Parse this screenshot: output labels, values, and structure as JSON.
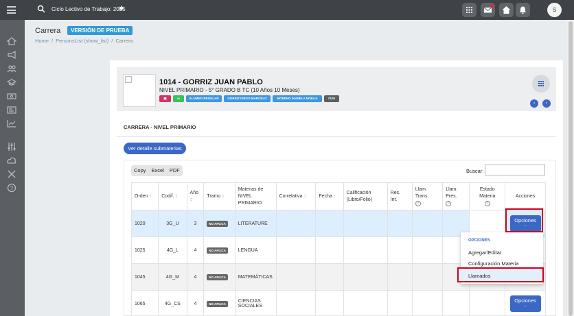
{
  "topbar": {
    "cycle_label": "Ciclo Lectivo de Trabajo: 2025",
    "avatar_initial": "S"
  },
  "header": {
    "title": "Carrera",
    "version_badge": "VERSIÓN DE PRUEBA",
    "breadcrumb": [
      "Home",
      "PersonsList (show_list)",
      "Carrera"
    ]
  },
  "student": {
    "name": "1014 - GORRIZ JUAN PABLO",
    "level": "NIVEL PRIMARIO - 5° GRADO B TC (10 Años 10 Meses)",
    "chips": [
      "ALUMNO REGULAR",
      "GORRIZ DIEGO MARCELO",
      "MORENO DANIELA NOELIA",
      "#105"
    ]
  },
  "section": {
    "title": "CARRERA - NIVEL PRIMARIO",
    "detail_button": "Ver detalle submaterias"
  },
  "table": {
    "export_buttons": [
      "Copy",
      "Excel",
      "PDF"
    ],
    "search_label": "Buscar:",
    "headers": {
      "orden": "Orden",
      "codif": "Codif.",
      "anio": "Año",
      "tramo": "Tramo",
      "materias_l1": "Materias de",
      "materias_l2": "NIVEL",
      "materias_l3": "PRIMARIO",
      "correlativa": "Correlativa",
      "fecha": "Fecha",
      "calif_l1": "Calificación",
      "calif_l2": "(Libro/Folio)",
      "res_l1": "Res.",
      "res_l2": "Int.",
      "lltrans_l1": "Llam.",
      "lltrans_l2": "Trans.",
      "llpres_l1": "Llam.",
      "llpres_l2": "Pres.",
      "estado_l1": "Estado",
      "estado_l2": "Materia",
      "acciones": "Acciones"
    },
    "rows": [
      {
        "orden": "1020",
        "codif": "3G_U",
        "anio": "3",
        "tramo": "NO APLICA",
        "materia": "LITERATURE",
        "materia2": ""
      },
      {
        "orden": "1025",
        "codif": "4G_L",
        "anio": "4",
        "tramo": "NO APLICA",
        "materia": "LENGUA",
        "materia2": ""
      },
      {
        "orden": "1045",
        "codif": "4G_M",
        "anio": "4",
        "tramo": "NO APLICA",
        "materia": "MATEMÁTICAS",
        "materia2": ""
      },
      {
        "orden": "1065",
        "codif": "4G_CS",
        "anio": "4",
        "tramo": "NO APLICA",
        "materia": "CIENCIAS",
        "materia2": "SOCIALES"
      }
    ],
    "options_button": "Opciones"
  },
  "dropdown": {
    "header": "OPCIONES",
    "items": [
      "Agregar/Editar",
      "Configuración Materia",
      "Llamados"
    ]
  },
  "colors": {
    "primary": "#3a68c4",
    "topbar": "#3f4347",
    "sidebar": "#5b5f63",
    "highlight": "#d0001c"
  }
}
